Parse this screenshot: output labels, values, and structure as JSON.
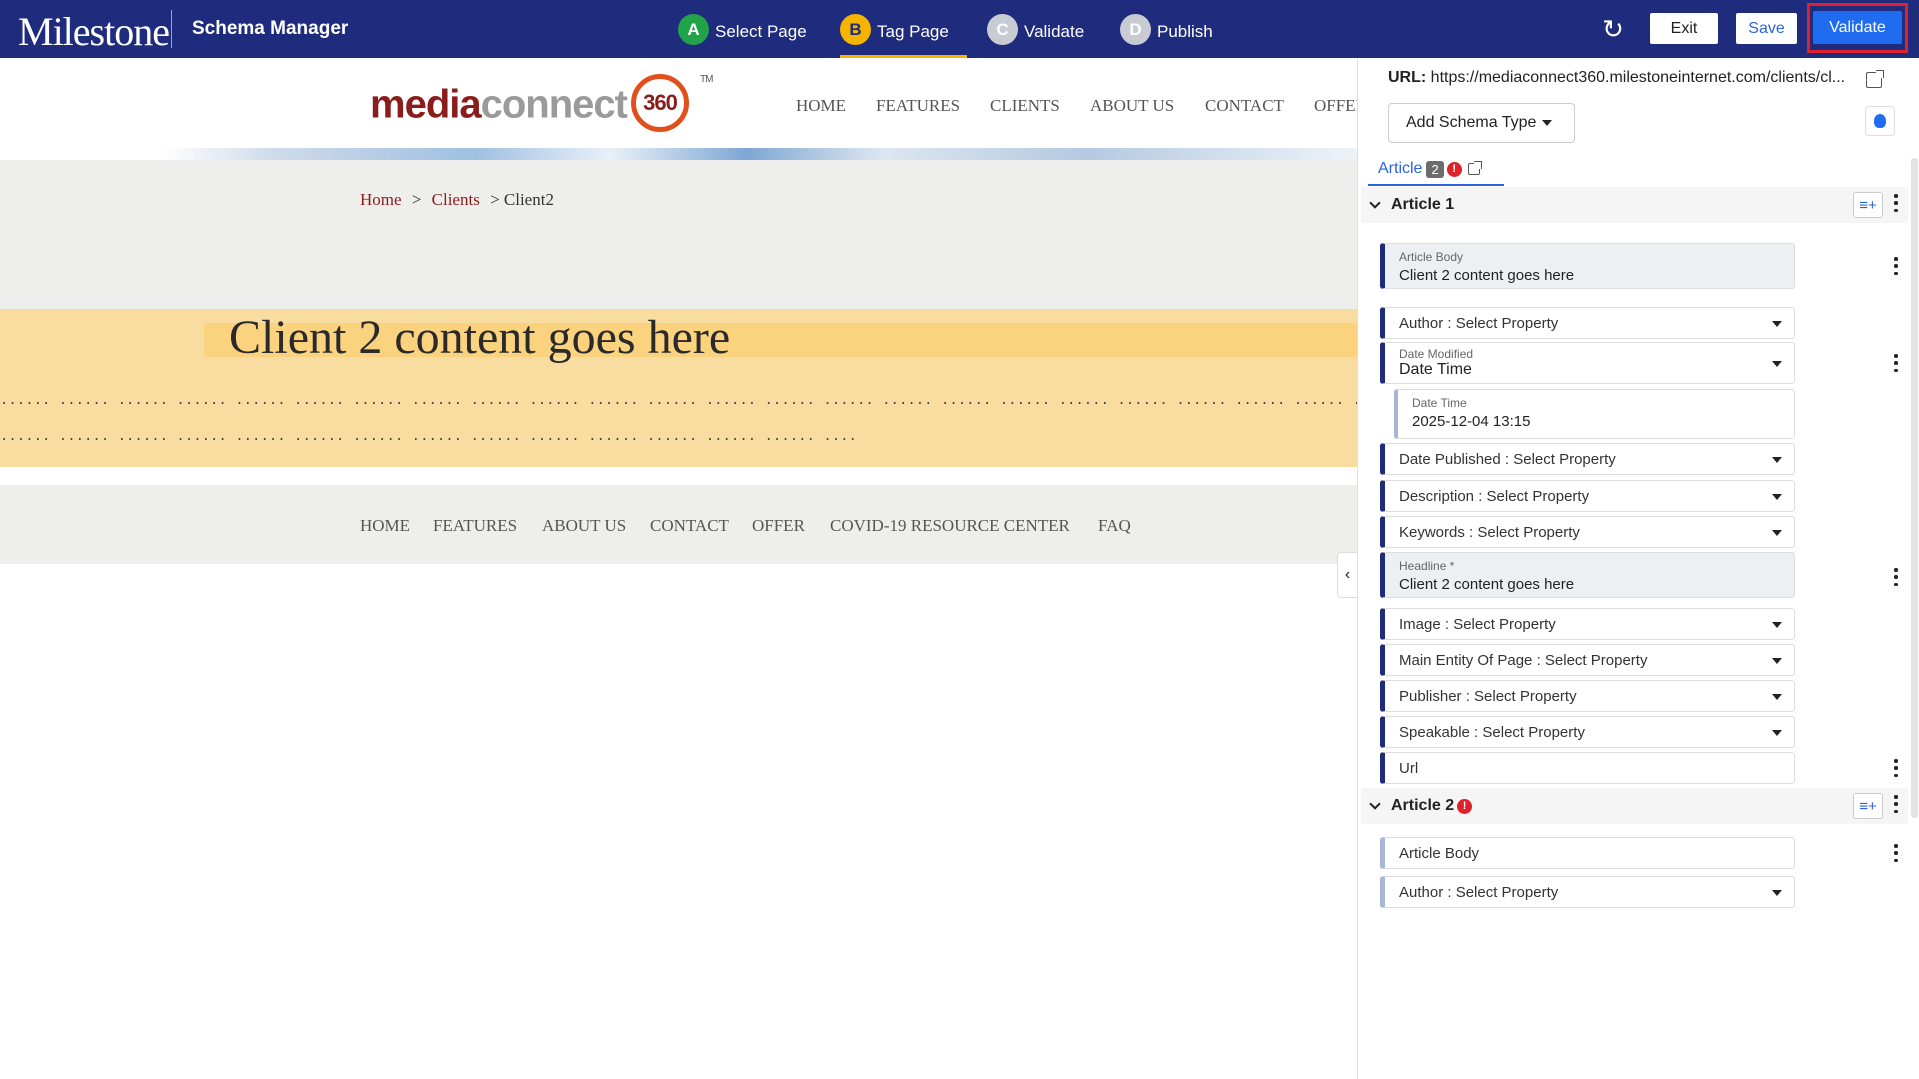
{
  "topbar": {
    "logo": "Milestone",
    "app_title": "Schema Manager",
    "steps": [
      {
        "letter": "A",
        "label": "Select Page"
      },
      {
        "letter": "B",
        "label": "Tag Page"
      },
      {
        "letter": "C",
        "label": "Validate"
      },
      {
        "letter": "D",
        "label": "Publish"
      }
    ],
    "exit_label": "Exit",
    "save_label": "Save",
    "validate_label": "Validate"
  },
  "site": {
    "logo_media": "media",
    "logo_connect": "connect",
    "logo_360": "360",
    "logo_tm": "TM",
    "nav": [
      "HOME",
      "FEATURES",
      "CLIENTS",
      "ABOUT US",
      "CONTACT",
      "OFFER"
    ],
    "breadcrumb": {
      "home": "Home",
      "sep": ">",
      "clients": "Clients",
      "current": "> Client2"
    },
    "hero_title": "Client 2 content goes here",
    "dots_line1": "...... ...... ...... ...... ...... ...... ...... ...... ...... ...... ...... ...... ...... ...... ...... ...... ...... ...... ...... ...... ...... ...... ...... ...... ...... ...... ...... ...... ...... ...... ...... ...... ...... ...... ...... ...... ...... ...... ...... ...... ...... ...... ...... ...... ...... ...... ...... ...... ...... ...... ...... ......",
    "dots_line2": "...... ...... ...... ...... ...... ...... ...... ...... ...... ...... ...... ...... ...... ...... ...... ...... ...... ...... ...... ...... ...... ...... ...... ...... ...... ...... ...... ...... ...... ...... ...... ...... ...... ...... ...... ...... ...... ...... ...... ......",
    "footer_nav": [
      "HOME",
      "FEATURES",
      "ABOUT US",
      "CONTACT",
      "OFFER",
      "COVID-19 RESOURCE CENTER",
      "FAQ"
    ]
  },
  "panel": {
    "url_label": "URL:",
    "url_value": "https://mediaconnect360.milestoneinternet.com/clients/cl...",
    "add_schema_label": "Add Schema Type",
    "tab_label": "Article",
    "tab_count": "2",
    "error_mark": "!",
    "article1": {
      "title": "Article 1",
      "article_body_label": "Article Body",
      "article_body_value": "Client 2 content goes here",
      "author": "Author : Select Property",
      "date_modified_label": "Date Modified",
      "date_modified_value": "Date Time",
      "date_time_label": "Date Time",
      "date_time_value": "2025-12-04 13:15",
      "date_published": "Date Published : Select Property",
      "description": "Description : Select Property",
      "keywords": "Keywords : Select Property",
      "headline_label": "Headline *",
      "headline_value": "Client 2 content goes here",
      "image": "Image : Select Property",
      "main_entity": "Main Entity Of Page : Select Property",
      "publisher": "Publisher : Select Property",
      "speakable": "Speakable : Select Property",
      "url": "Url"
    },
    "article2": {
      "title": "Article 2",
      "article_body": "Article Body",
      "author": "Author : Select Property"
    }
  },
  "colors": {
    "topbar": "#1f2b7c",
    "accent_blue": "#1f6cf0",
    "highlight_red": "#e0202a",
    "hero_bg": "#f9dca0"
  }
}
